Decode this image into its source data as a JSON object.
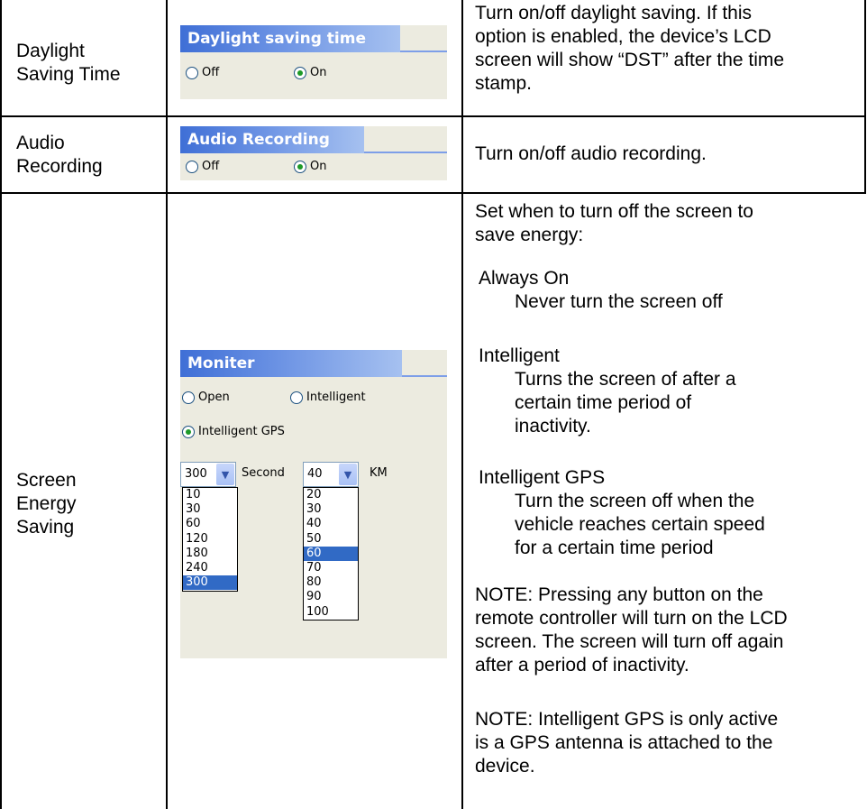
{
  "rows": [
    {
      "label_lines": [
        "Daylight",
        "Saving Time"
      ],
      "panel": {
        "title": "Daylight saving time",
        "options": [
          {
            "label": "Off",
            "selected": false
          },
          {
            "label": "On",
            "selected": true
          }
        ]
      },
      "description_lines": [
        "Turn on/off daylight saving. If this",
        "option is enabled, the device’s LCD",
        "screen will show “DST” after the time",
        "stamp."
      ]
    },
    {
      "label_lines": [
        "Audio",
        "Recording"
      ],
      "panel": {
        "title": "Audio Recording",
        "options": [
          {
            "label": "Off",
            "selected": false
          },
          {
            "label": "On",
            "selected": true
          }
        ]
      },
      "description_lines": [
        "Turn on/off audio recording."
      ]
    },
    {
      "label_lines": [
        "Screen",
        "Energy",
        "Saving"
      ],
      "panel": {
        "title": "Moniter",
        "options": [
          {
            "label": "Open",
            "selected": false
          },
          {
            "label": "Intelligent",
            "selected": false
          },
          {
            "label": "Intelligent GPS",
            "selected": true
          }
        ],
        "second_select": {
          "value": "300",
          "unit": "Second",
          "options": [
            "10",
            "30",
            "60",
            "120",
            "180",
            "240",
            "300"
          ],
          "selected": "300"
        },
        "km_select": {
          "value": "40",
          "unit": "KM",
          "options": [
            "20",
            "30",
            "40",
            "50",
            "60",
            "70",
            "80",
            "90",
            "100"
          ],
          "selected": "60"
        }
      },
      "description": {
        "intro_lines": [
          "Set when to turn off the screen to",
          "save energy:"
        ],
        "modes": [
          {
            "name": "Always On",
            "detail_lines": [
              "Never turn the screen off"
            ]
          },
          {
            "name": "Intelligent",
            "detail_lines": [
              "Turns the screen of after a",
              "certain time period of",
              "inactivity."
            ]
          },
          {
            "name": "Intelligent GPS",
            "detail_lines": [
              "Turn the screen off when the",
              "vehicle reaches certain speed",
              "for a certain time period"
            ]
          }
        ],
        "note1_lines": [
          "NOTE: Pressing any button on the",
          "remote controller will turn on the LCD",
          "screen. The screen will turn off again",
          "after a period of inactivity."
        ],
        "note2_lines": [
          "NOTE: Intelligent GPS is only active",
          "is a GPS antenna is attached to the",
          "device."
        ]
      }
    }
  ]
}
